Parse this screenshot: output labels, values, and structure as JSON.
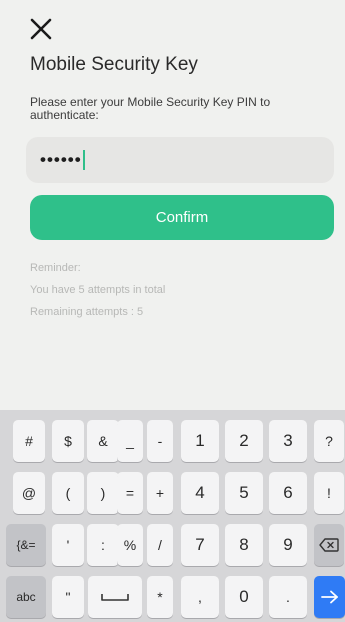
{
  "header": {
    "close_icon": "close-icon",
    "title": "Mobile Security Key"
  },
  "form": {
    "instructions": "Please enter your Mobile Security Key PIN to authenticate:",
    "pin_value": "••••••",
    "confirm_label": "Confirm"
  },
  "reminder": {
    "heading": "Reminder:",
    "attempts_total": "You have 5 attempts in total",
    "attempts_remaining": "Remaining attempts : 5"
  },
  "keyboard": {
    "rows": [
      [
        "#",
        "$",
        "&",
        "_",
        "-",
        "1",
        "2",
        "3",
        "?"
      ],
      [
        "@",
        "(",
        ")",
        "=",
        "+",
        "4",
        "5",
        "6",
        "!"
      ],
      [
        "{&=",
        "'",
        ":",
        "%",
        "/",
        "7",
        "8",
        "9",
        "backspace"
      ],
      [
        "abc",
        "\"",
        "space",
        "*",
        ",",
        "0",
        ".",
        "enter"
      ]
    ],
    "icons": {
      "backspace": "backspace-icon",
      "space": "space-bar-icon",
      "enter": "enter-arrow-icon"
    },
    "colors": {
      "action_key": "#2f7bf5",
      "confirm": "#2fc08a"
    }
  }
}
